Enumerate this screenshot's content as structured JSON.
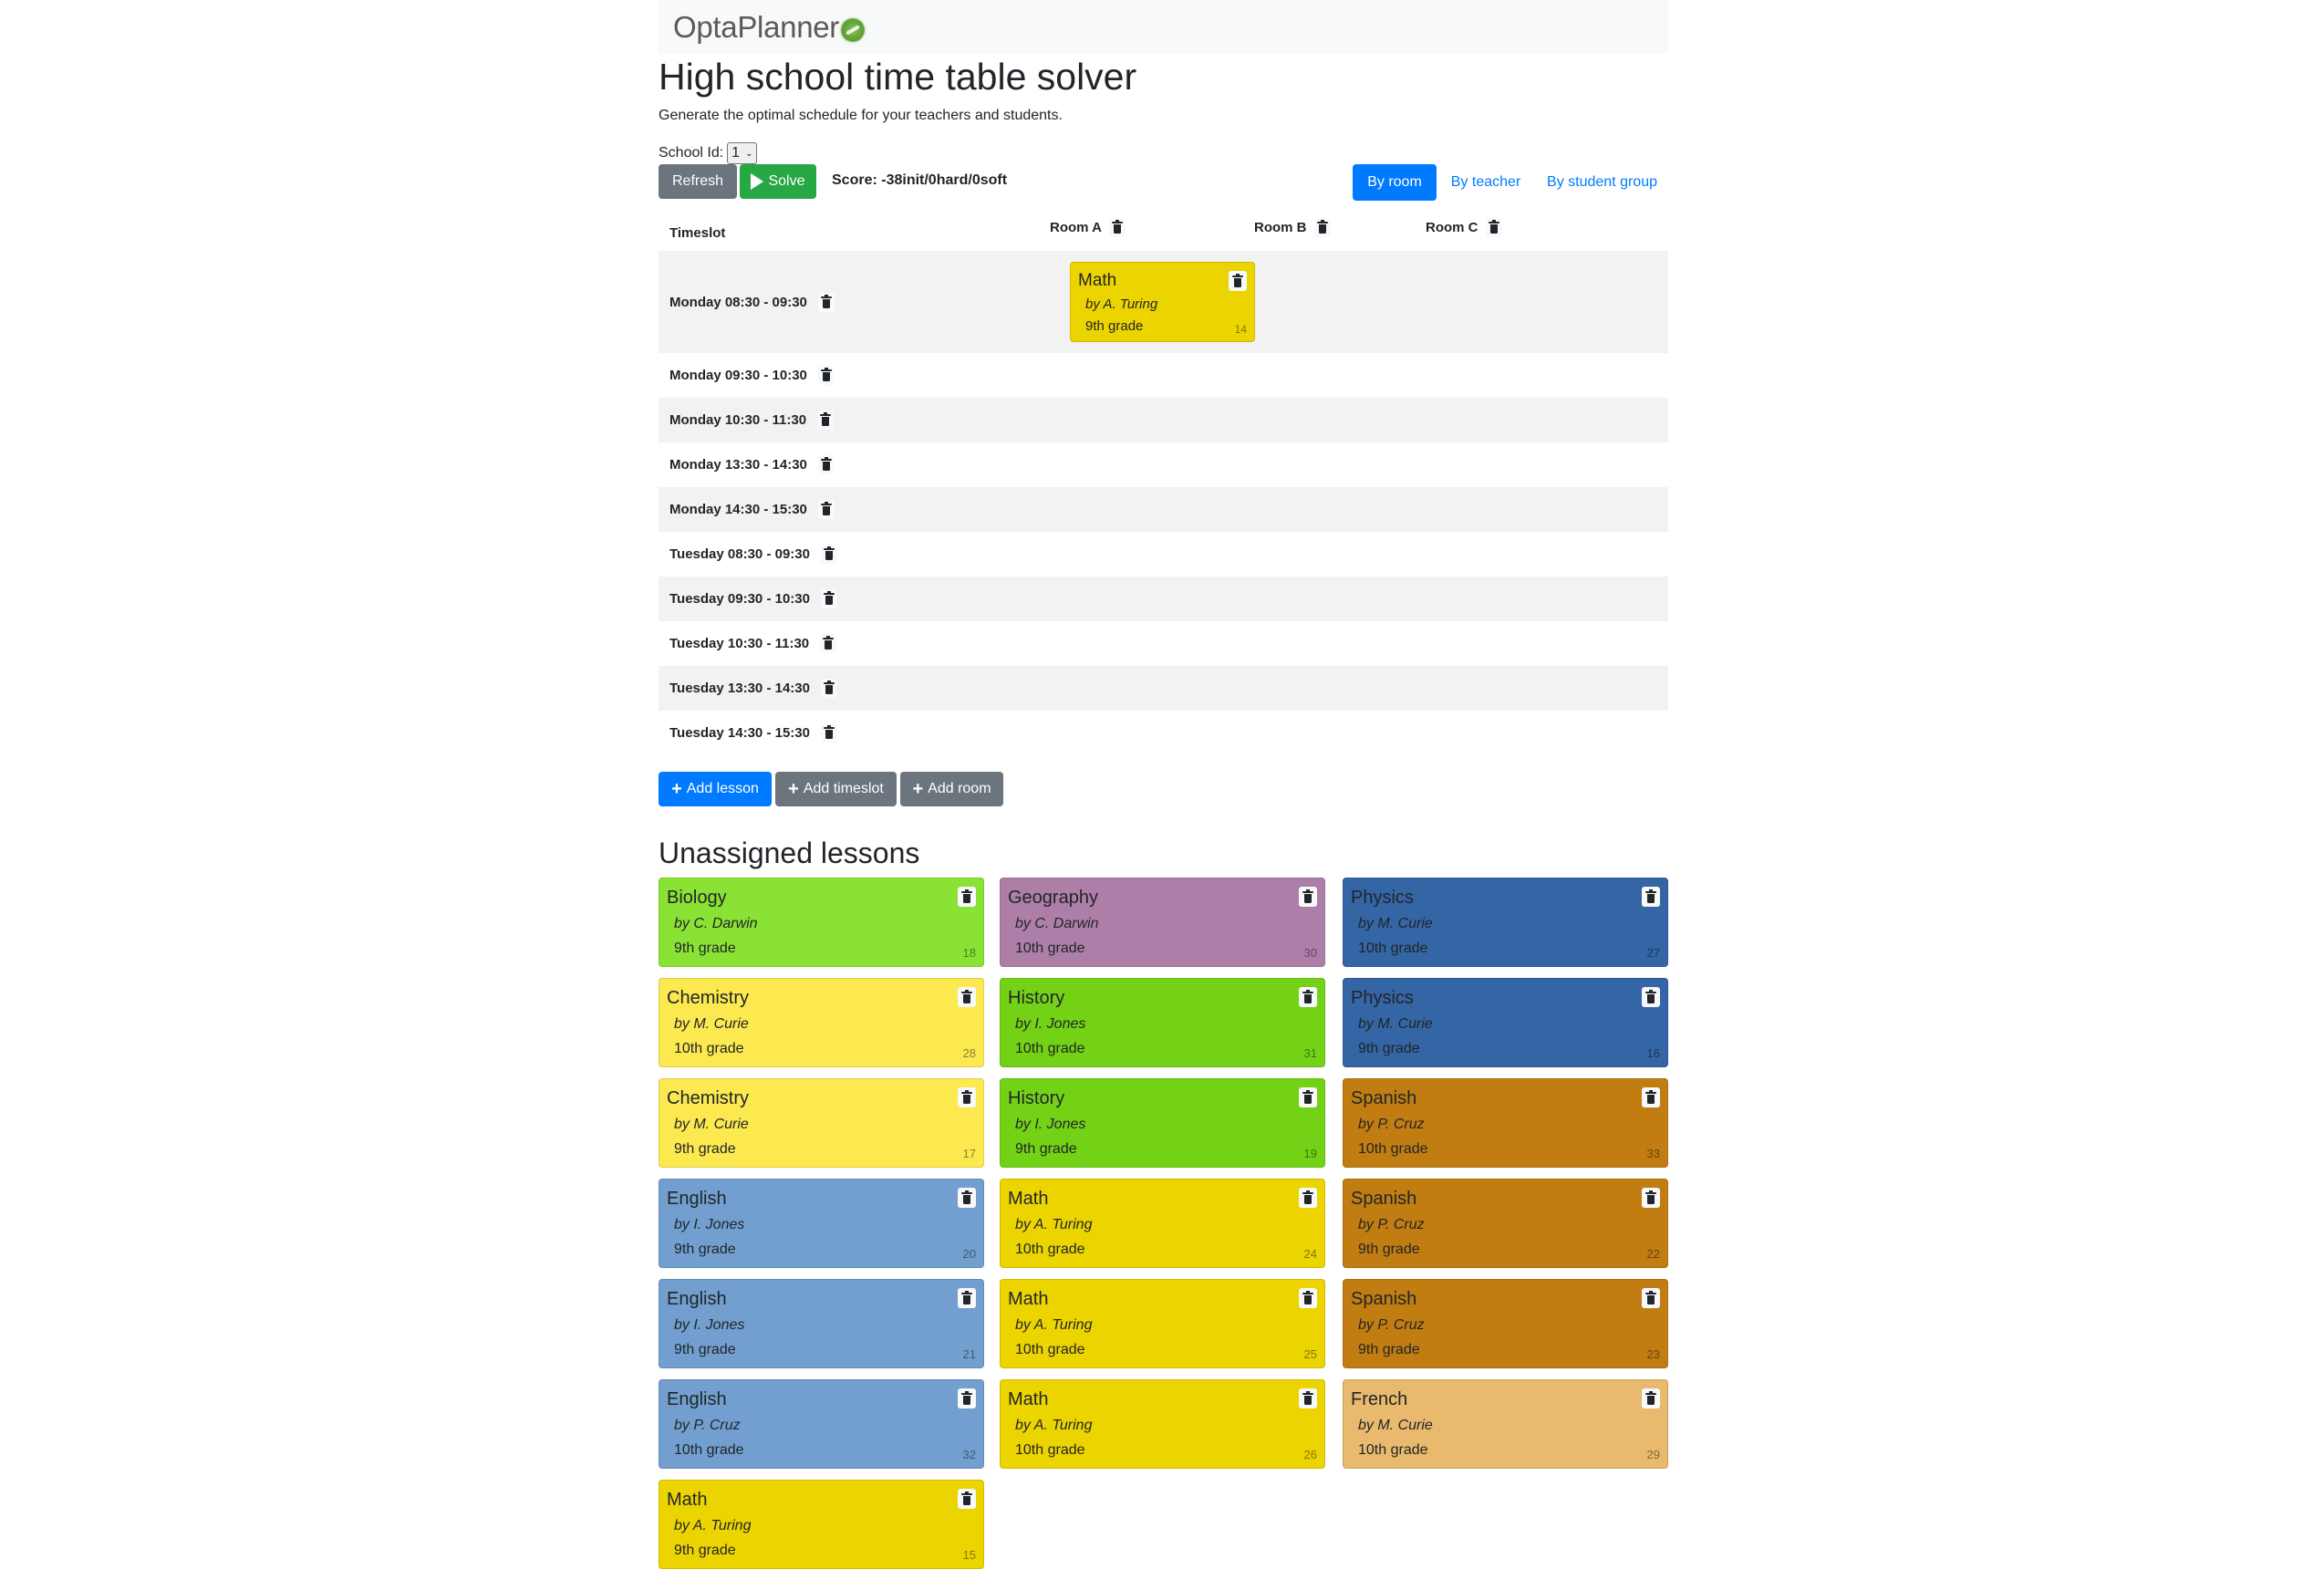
{
  "navbar": {
    "logo_text": "OptaPlanner",
    "logo_icon": "optaplanner-leaf-icon"
  },
  "page": {
    "title": "High school time table solver",
    "subtitle": "Generate the optimal schedule for your teachers and students."
  },
  "controls": {
    "school_id_label": "School Id:",
    "school_id_value": "1",
    "refresh_label": "Refresh",
    "solve_label": "Solve",
    "score": "Score: -38init/0hard/0soft"
  },
  "view_tabs": [
    {
      "label": "By room",
      "active": true
    },
    {
      "label": "By teacher",
      "active": false
    },
    {
      "label": "By student group",
      "active": false
    }
  ],
  "colors": {
    "primary": "#007bff",
    "secondary": "#6c757d",
    "success": "#28a745",
    "navbar_bg": "#f8f9fa",
    "row_stripe": "#f2f2f2"
  },
  "timetable": {
    "timeslot_header": "Timeslot",
    "rooms": [
      "Room A",
      "Room B",
      "Room C"
    ],
    "timeslots": [
      "Monday 08:30 - 09:30",
      "Monday 09:30 - 10:30",
      "Monday 10:30 - 11:30",
      "Monday 13:30 - 14:30",
      "Monday 14:30 - 15:30",
      "Tuesday 08:30 - 09:30",
      "Tuesday 09:30 - 10:30",
      "Tuesday 10:30 - 11:30",
      "Tuesday 13:30 - 14:30",
      "Tuesday 14:30 - 15:30"
    ],
    "assigned": [
      {
        "timeslot": "Monday 08:30 - 09:30",
        "room": "Room A",
        "subject": "Math",
        "teacher": "by A. Turing",
        "group": "9th grade",
        "id": "14",
        "color": "#ecd400"
      }
    ]
  },
  "add_buttons": {
    "add_lesson": "Add lesson",
    "add_timeslot": "Add timeslot",
    "add_room": "Add room"
  },
  "unassigned": {
    "heading": "Unassigned lessons",
    "lessons": [
      {
        "subject": "Biology",
        "teacher": "by C. Darwin",
        "group": "9th grade",
        "id": "18",
        "color": "#8ae234"
      },
      {
        "subject": "Geography",
        "teacher": "by C. Darwin",
        "group": "10th grade",
        "id": "30",
        "color": "#ad7fa8"
      },
      {
        "subject": "Physics",
        "teacher": "by M. Curie",
        "group": "10th grade",
        "id": "27",
        "color": "#3465a4"
      },
      {
        "subject": "Chemistry",
        "teacher": "by M. Curie",
        "group": "10th grade",
        "id": "28",
        "color": "#fce94f"
      },
      {
        "subject": "History",
        "teacher": "by I. Jones",
        "group": "10th grade",
        "id": "31",
        "color": "#73d216"
      },
      {
        "subject": "Physics",
        "teacher": "by M. Curie",
        "group": "9th grade",
        "id": "16",
        "color": "#3465a4"
      },
      {
        "subject": "Chemistry",
        "teacher": "by M. Curie",
        "group": "9th grade",
        "id": "17",
        "color": "#fce94f"
      },
      {
        "subject": "History",
        "teacher": "by I. Jones",
        "group": "9th grade",
        "id": "19",
        "color": "#73d216"
      },
      {
        "subject": "Spanish",
        "teacher": "by P. Cruz",
        "group": "10th grade",
        "id": "33",
        "color": "#c17d11"
      },
      {
        "subject": "English",
        "teacher": "by I. Jones",
        "group": "9th grade",
        "id": "20",
        "color": "#729fcf"
      },
      {
        "subject": "Math",
        "teacher": "by A. Turing",
        "group": "10th grade",
        "id": "24",
        "color": "#ecd400"
      },
      {
        "subject": "Spanish",
        "teacher": "by P. Cruz",
        "group": "9th grade",
        "id": "22",
        "color": "#c17d11"
      },
      {
        "subject": "English",
        "teacher": "by I. Jones",
        "group": "9th grade",
        "id": "21",
        "color": "#729fcf"
      },
      {
        "subject": "Math",
        "teacher": "by A. Turing",
        "group": "10th grade",
        "id": "25",
        "color": "#ecd400"
      },
      {
        "subject": "Spanish",
        "teacher": "by P. Cruz",
        "group": "9th grade",
        "id": "23",
        "color": "#c17d11"
      },
      {
        "subject": "English",
        "teacher": "by P. Cruz",
        "group": "10th grade",
        "id": "32",
        "color": "#729fcf"
      },
      {
        "subject": "Math",
        "teacher": "by A. Turing",
        "group": "10th grade",
        "id": "26",
        "color": "#ecd400"
      },
      {
        "subject": "French",
        "teacher": "by M. Curie",
        "group": "10th grade",
        "id": "29",
        "color": "#e9b96e"
      },
      {
        "subject": "Math",
        "teacher": "by A. Turing",
        "group": "9th grade",
        "id": "15",
        "color": "#ecd400"
      }
    ]
  }
}
